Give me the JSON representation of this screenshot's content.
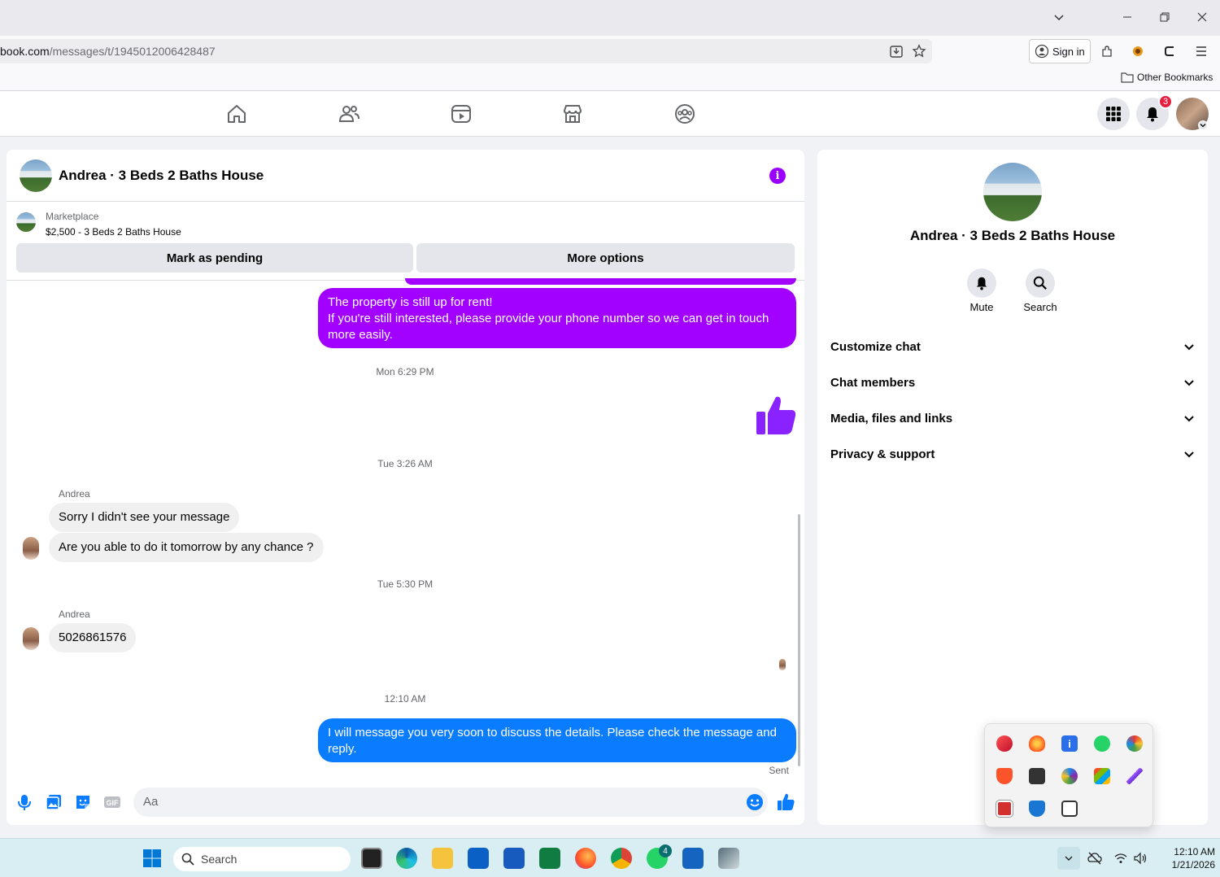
{
  "browser": {
    "url_host": "book.com",
    "url_path": "/messages/t/1945012006428487",
    "sign_in_label": "Sign in",
    "other_bookmarks": "Other Bookmarks"
  },
  "fbnav": {
    "notification_count": "3"
  },
  "chat": {
    "title": "Andrea · 3 Beds 2 Baths House",
    "marketplace_label": "Marketplace",
    "listing_line": "$2,500 - 3 Beds 2 Baths House",
    "mark_pending_label": "Mark as pending",
    "more_options_label": "More options",
    "messages": {
      "msg1_line1": "The property is still up for rent!",
      "msg1_line2": "If you're still interested, please provide your phone number so we can get in touch more easily.",
      "ts1": "Mon 6:29 PM",
      "ts2": "Tue 3:26 AM",
      "sender1": "Andrea",
      "msg2": "Sorry I didn't see your message",
      "msg3": "Are you able to do it tomorrow by any chance ?",
      "ts3": "Tue 5:30 PM",
      "sender2": "Andrea",
      "msg4": "5026861576",
      "ts4": "12:10 AM",
      "msg5": "I will message you very soon to discuss the details. Please check the message and reply.",
      "sent_status": "Sent"
    },
    "composer_placeholder": "Aa",
    "accent_color": "#a200ff",
    "blue_color": "#0a7cff"
  },
  "info_panel": {
    "name": "Andrea · 3 Beds 2 Baths House",
    "mute_label": "Mute",
    "search_label": "Search",
    "sections": [
      "Customize chat",
      "Chat members",
      "Media, files and links",
      "Privacy & support"
    ]
  },
  "taskbar": {
    "search_label": "Search",
    "whatsapp_badge": "4",
    "time": "12:10 AM",
    "date": "1/21/2026"
  }
}
